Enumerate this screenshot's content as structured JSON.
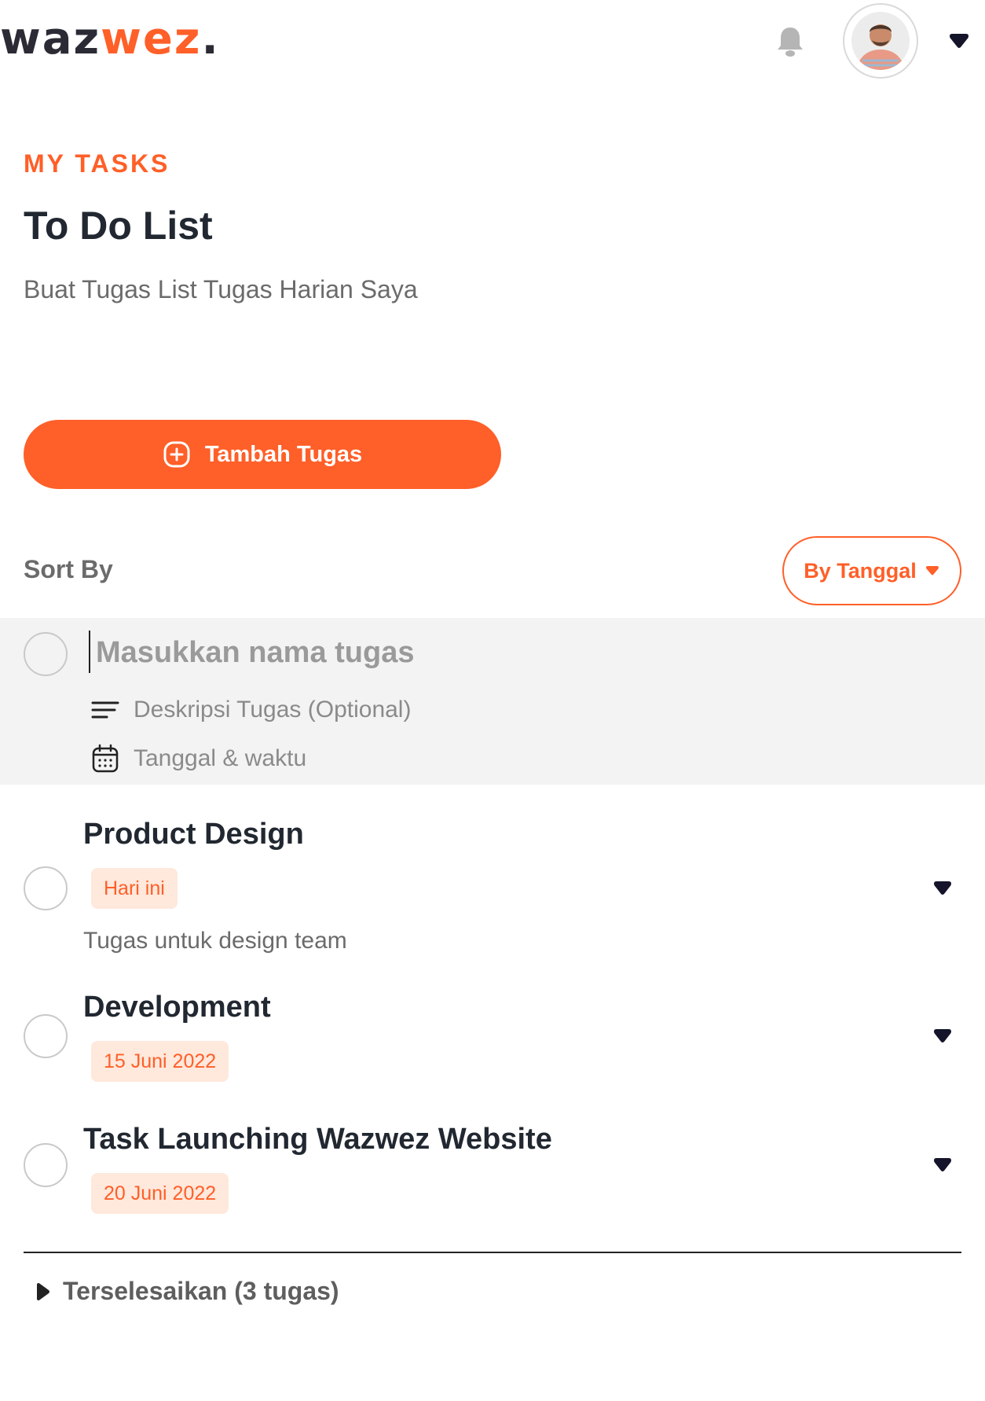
{
  "brand": {
    "part1": "waz",
    "part2": "wez",
    "dot": "."
  },
  "colors": {
    "accent": "#ff5f28",
    "chip_bg": "#ffe8dc",
    "panel_bg": "#f3f3f3",
    "text_dark": "#222831"
  },
  "header": {
    "icons": [
      "bell-icon",
      "avatar",
      "chevron-down-icon"
    ]
  },
  "hero": {
    "eyebrow": "MY TASKS",
    "title": "To Do List",
    "subtitle": "Buat Tugas List Tugas Harian Saya"
  },
  "add_button": {
    "label": "Tambah Tugas",
    "icon": "plus-circle-icon"
  },
  "sort": {
    "label": "Sort By",
    "selected": "By Tanggal"
  },
  "new_task": {
    "name_placeholder": "Masukkan nama tugas",
    "description_placeholder": "Deskripsi Tugas (Optional)",
    "datetime_placeholder": "Tanggal & waktu"
  },
  "tasks": [
    {
      "title": "Product Design",
      "date": "Hari ini",
      "description": "Tugas untuk design team"
    },
    {
      "title": "Development",
      "date": "15 Juni 2022"
    },
    {
      "title": "Task Launching Wazwez Website",
      "date": "20 Juni 2022"
    }
  ],
  "completed": {
    "label": "Terselesaikan (3 tugas)"
  }
}
